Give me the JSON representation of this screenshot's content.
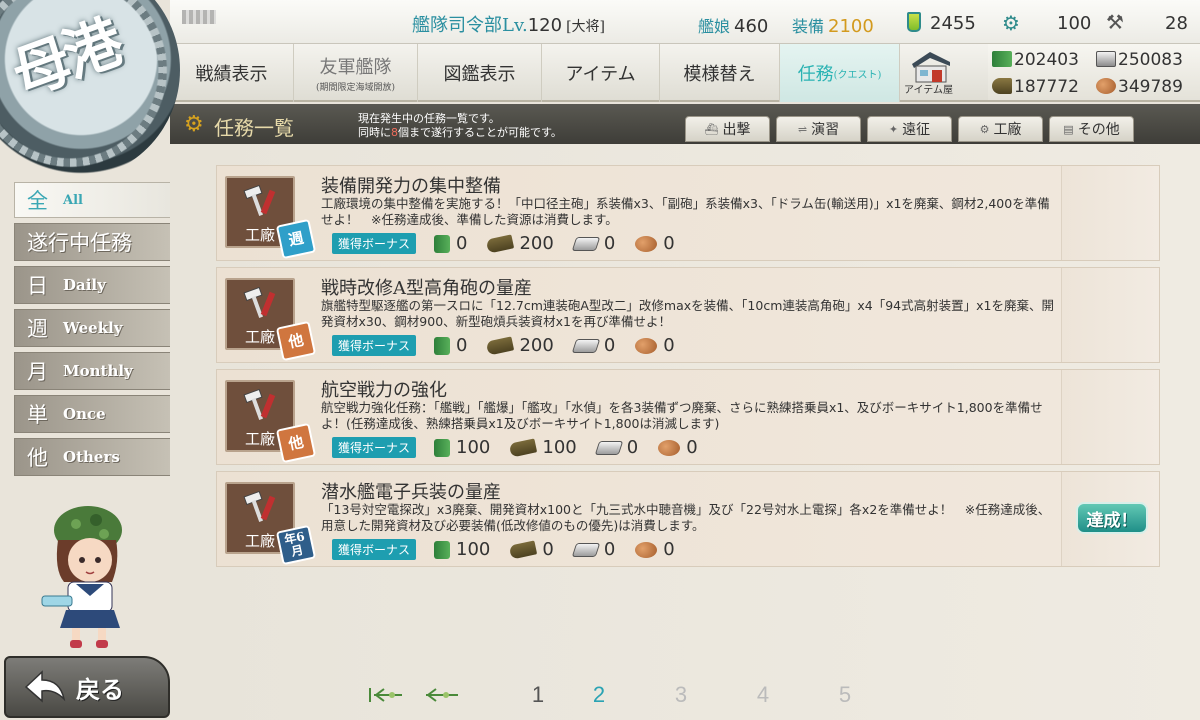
{
  "header": {
    "hq_label": "艦隊司令部Lv.",
    "hq_level": "120",
    "rank": "[大将]",
    "ship_label": "艦娘",
    "ship_count": "460",
    "equip_label": "装備",
    "equip_count": "2100",
    "buckets": "2455",
    "dev_mats": "100",
    "screws": "28"
  },
  "menu": {
    "items": [
      {
        "label": "戦績表示",
        "sub": ""
      },
      {
        "label": "友軍艦隊",
        "sub": "(期間限定海域開放)"
      },
      {
        "label": "図鑑表示",
        "sub": ""
      },
      {
        "label": "アイテム",
        "sub": ""
      },
      {
        "label": "模様替え",
        "sub": ""
      },
      {
        "label": "任務",
        "sub": "(クエスト)"
      }
    ],
    "shop_label": "アイテム屋"
  },
  "resources": {
    "fuel": "202403",
    "steel": "250083",
    "ammo": "187772",
    "bauxite": "349789"
  },
  "emblem": "母港",
  "titlebar": {
    "title": "任務一覧",
    "desc_line1": "現在発生中の任務一覧です。",
    "desc_line2_a": "同時に",
    "desc_line2_b": "8",
    "desc_line2_c": "個まで遂行することが可能です。",
    "tabs": [
      "出撃",
      "演習",
      "遠征",
      "工廠",
      "その他"
    ]
  },
  "sidebar": {
    "items": [
      {
        "kan": "全",
        "en": "All"
      },
      {
        "kan": "遂行中任務",
        "en": ""
      },
      {
        "kan": "日",
        "en": "Daily"
      },
      {
        "kan": "週",
        "en": "Weekly"
      },
      {
        "kan": "月",
        "en": "Monthly"
      },
      {
        "kan": "単",
        "en": "Once"
      },
      {
        "kan": "他",
        "en": "Others"
      }
    ]
  },
  "back_label": "戻る",
  "quests": [
    {
      "category": "工廠",
      "freq": "週",
      "title": "装備開発力の集中整備",
      "desc": "工廠環境の集中整備を実施する！「中口径主砲」系装備x3、「副砲」系装備x3、「ドラム缶(輸送用)」x1を廃棄、鋼材2,400を準備せよ！　※任務達成後、準備した資源は消費します。",
      "bonus": "獲得ボーナス",
      "fuel": "0",
      "ammo": "200",
      "steel": "0",
      "bauxite": "0",
      "status": ""
    },
    {
      "category": "工廠",
      "freq": "他",
      "title": "戦時改修A型高角砲の量産",
      "desc": "旗艦特型駆逐艦の第一スロに「12.7cm連装砲A型改二」改修maxを装備、「10cm連装高角砲」x4「94式高射装置」x1を廃棄、開発資材x30、鋼材900、新型砲熕兵装資材x1を再び準備せよ！",
      "bonus": "獲得ボーナス",
      "fuel": "0",
      "ammo": "200",
      "steel": "0",
      "bauxite": "0",
      "status": ""
    },
    {
      "category": "工廠",
      "freq": "他",
      "title": "航空戦力の強化",
      "desc": "航空戦力強化任務：「艦戦」「艦爆」「艦攻」「水偵」を各3装備ずつ廃棄、さらに熟練搭乗員x1、及びボーキサイト1,800を準備せよ！(任務達成後、熟練搭乗員x1及びボーキサイト1,800は消滅します)",
      "bonus": "獲得ボーナス",
      "fuel": "100",
      "ammo": "100",
      "steel": "0",
      "bauxite": "0",
      "status": ""
    },
    {
      "category": "工廠",
      "freq": "年6月",
      "title": "潜水艦電子兵装の量産",
      "desc": "「13号対空電探改」x3廃棄、開発資材x100と「九三式水中聴音機」及び「22号対水上電探」各x2を準備せよ！　※任務達成後、用意した開発資材及び必要装備(低改修値のもの優先)は消費します。",
      "bonus": "獲得ボーナス",
      "fuel": "100",
      "ammo": "0",
      "steel": "0",
      "bauxite": "0",
      "status": "達成！"
    }
  ],
  "pager": {
    "pages": [
      "1",
      "2",
      "3",
      "4",
      "5"
    ],
    "current": "2"
  },
  "colors": {
    "accent": "#2aa3b3",
    "title_bar": "#4a4944",
    "bonus": "#1e9eb0",
    "weekly_badge": "#2f9fc9",
    "other_badge": "#d0763f"
  }
}
